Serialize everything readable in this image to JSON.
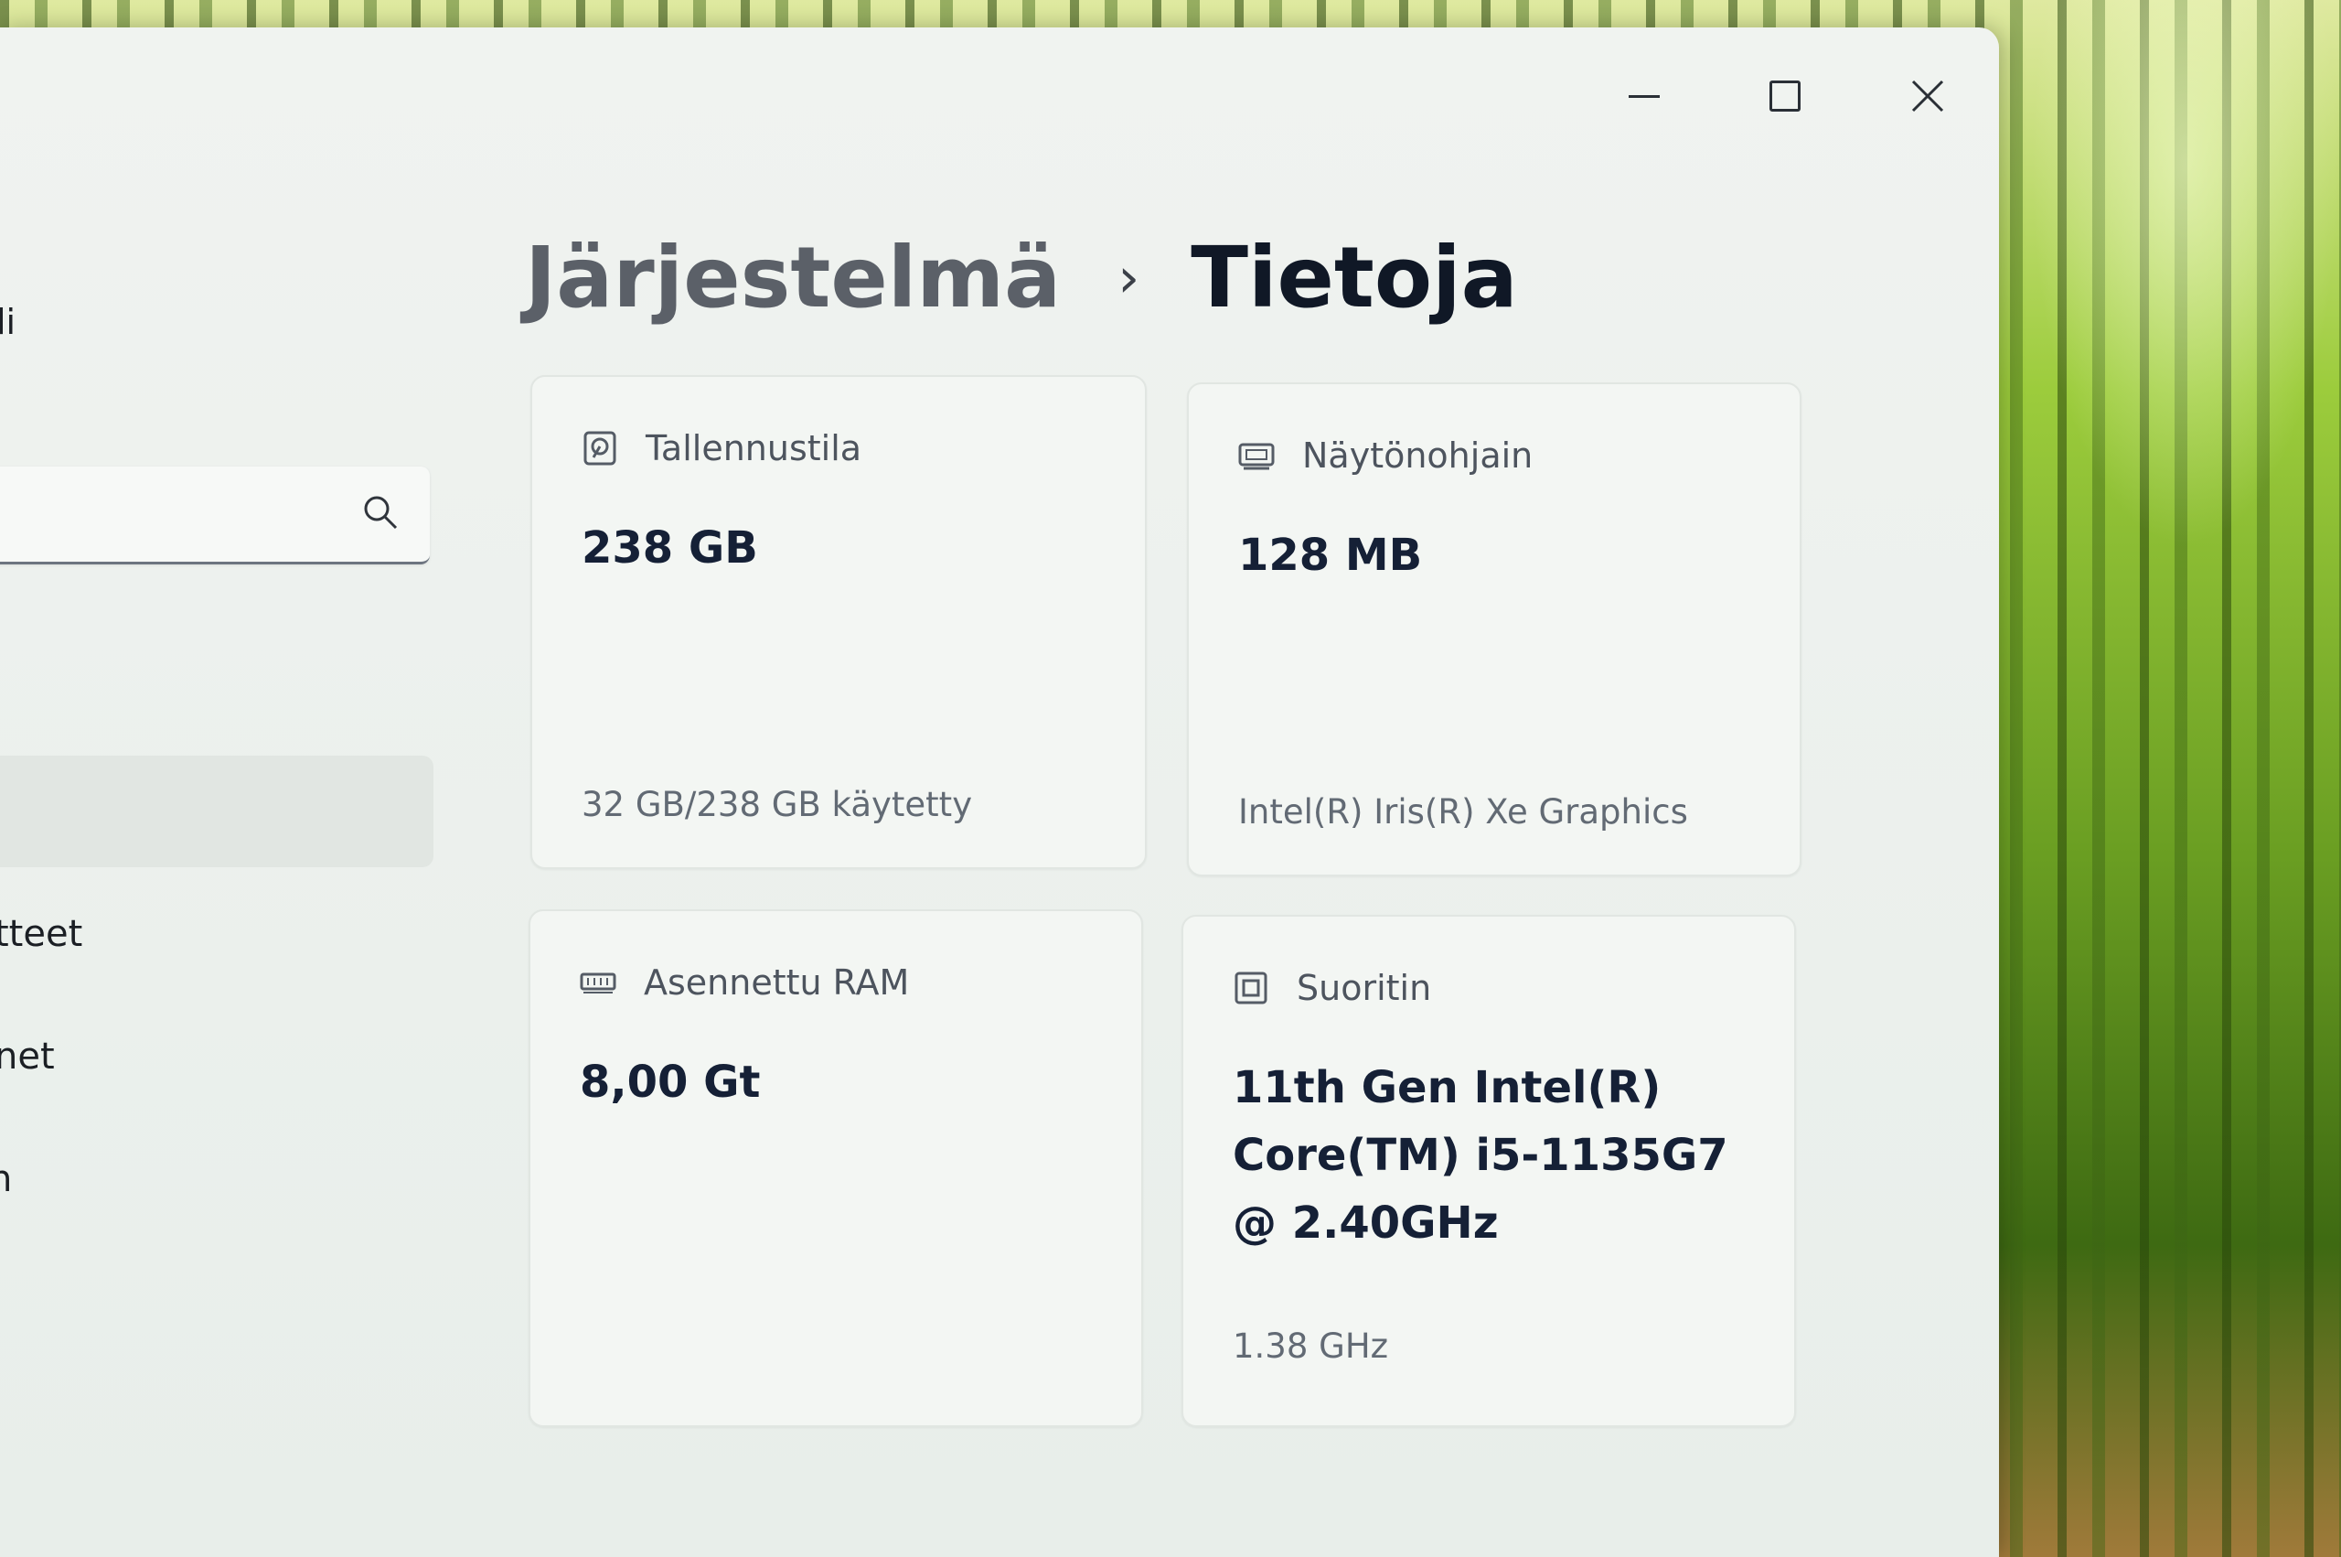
{
  "window": {
    "controls": {
      "minimize": "minimize-icon",
      "maximize": "maximize-icon",
      "close": "close-icon"
    }
  },
  "sidebar": {
    "fragments": [
      "li",
      "tteet",
      "net",
      "n"
    ],
    "search": {
      "placeholder": "",
      "icon": "search-icon"
    }
  },
  "breadcrumb": {
    "parent": "Järjestelmä",
    "separator": "›",
    "current": "Tietoja"
  },
  "cards": {
    "storage": {
      "icon": "storage-icon",
      "title": "Tallennustila",
      "value": "238 GB",
      "detail": "32 GB/238 GB käytetty"
    },
    "graphics": {
      "icon": "graphics-card-icon",
      "title": "Näytönohjain",
      "value": "128 MB",
      "detail": "Intel(R) Iris(R) Xe Graphics"
    },
    "ram": {
      "icon": "ram-icon",
      "title": "Asennettu RAM",
      "value": "8,00 Gt"
    },
    "processor": {
      "icon": "processor-icon",
      "title": "Suoritin",
      "value": "11th Gen Intel(R) Core(TM) i5-1135G7 @ 2.40GHz",
      "detail": "1.38 GHz"
    }
  }
}
